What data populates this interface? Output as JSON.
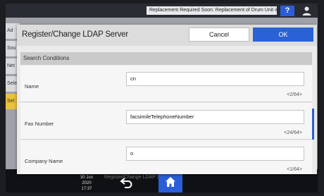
{
  "topbar": {
    "notice": "Replacement Required Soon: Replacement of Drum Unit is now necessary...",
    "help_label": "?"
  },
  "background": {
    "tabs": [
      "Ad",
      "Sou",
      "Net",
      "Sele",
      "Set"
    ],
    "bottom_title": "Register/Change LDAP Server",
    "date": "30 Jun 2020",
    "time": "17:37"
  },
  "dialog": {
    "title": "Register/Change LDAP Server",
    "cancel_label": "Cancel",
    "ok_label": "OK",
    "section_title": "Search Conditions",
    "fields": [
      {
        "label": "Name",
        "value": "cn",
        "counter": "<2/64>"
      },
      {
        "label": "Fax Number",
        "value": "facsimileTelephoneNumber",
        "counter": "<24/64>"
      },
      {
        "label": "Company Name",
        "value": "o",
        "counter": "<1/64>"
      }
    ]
  },
  "colors": {
    "accent": "#2a62d6",
    "dialog_bg": "#ebebeb",
    "section_header": "#cacaca"
  },
  "icons": [
    "user-icon",
    "back-arrow-icon",
    "home-icon"
  ]
}
